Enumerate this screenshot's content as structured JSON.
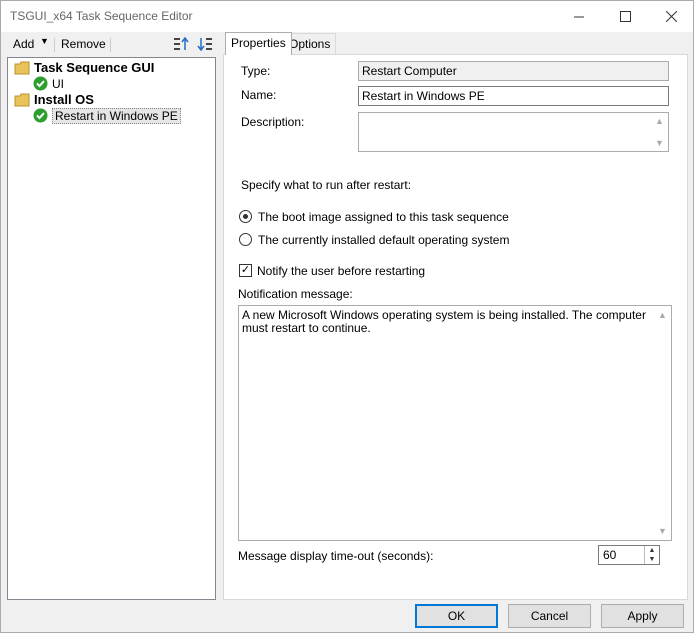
{
  "window": {
    "title": "TSGUI_x64 Task Sequence Editor"
  },
  "toolbar": {
    "add_label": "Add",
    "remove_label": "Remove"
  },
  "tree": {
    "items": [
      {
        "label": "Task Sequence GUI",
        "type": "group",
        "icon": "folder-icon"
      },
      {
        "label": "UI",
        "type": "step",
        "icon": "check-icon"
      },
      {
        "label": "Install OS",
        "type": "group",
        "icon": "folder-icon"
      },
      {
        "label": "Restart in Windows PE",
        "type": "step",
        "icon": "check-icon",
        "selected": true
      }
    ]
  },
  "tabs": [
    {
      "label": "Properties",
      "active": true
    },
    {
      "label": "Options",
      "active": false
    }
  ],
  "properties": {
    "type_label": "Type:",
    "type_value": "Restart Computer",
    "name_label": "Name:",
    "name_value": "Restart in Windows PE",
    "description_label": "Description:",
    "description_value": "",
    "run_after_label": "Specify what to run after restart:",
    "radio_boot_image": "The boot image assigned to this task sequence",
    "radio_default_os": "The currently installed default operating system",
    "selected_radio": "boot_image",
    "notify_label": "Notify the user before restarting",
    "notify_checked": true,
    "notification_message_label": "Notification message:",
    "notification_message": "A new Microsoft Windows operating system is being installed. The computer must restart to continue.",
    "timeout_label": "Message display time-out (seconds):",
    "timeout_value": "60"
  },
  "buttons": {
    "ok": "OK",
    "cancel": "Cancel",
    "apply": "Apply"
  },
  "colors": {
    "accent": "#0078d7",
    "check_green": "#2e9e2e",
    "folder": "#e8c35a"
  }
}
